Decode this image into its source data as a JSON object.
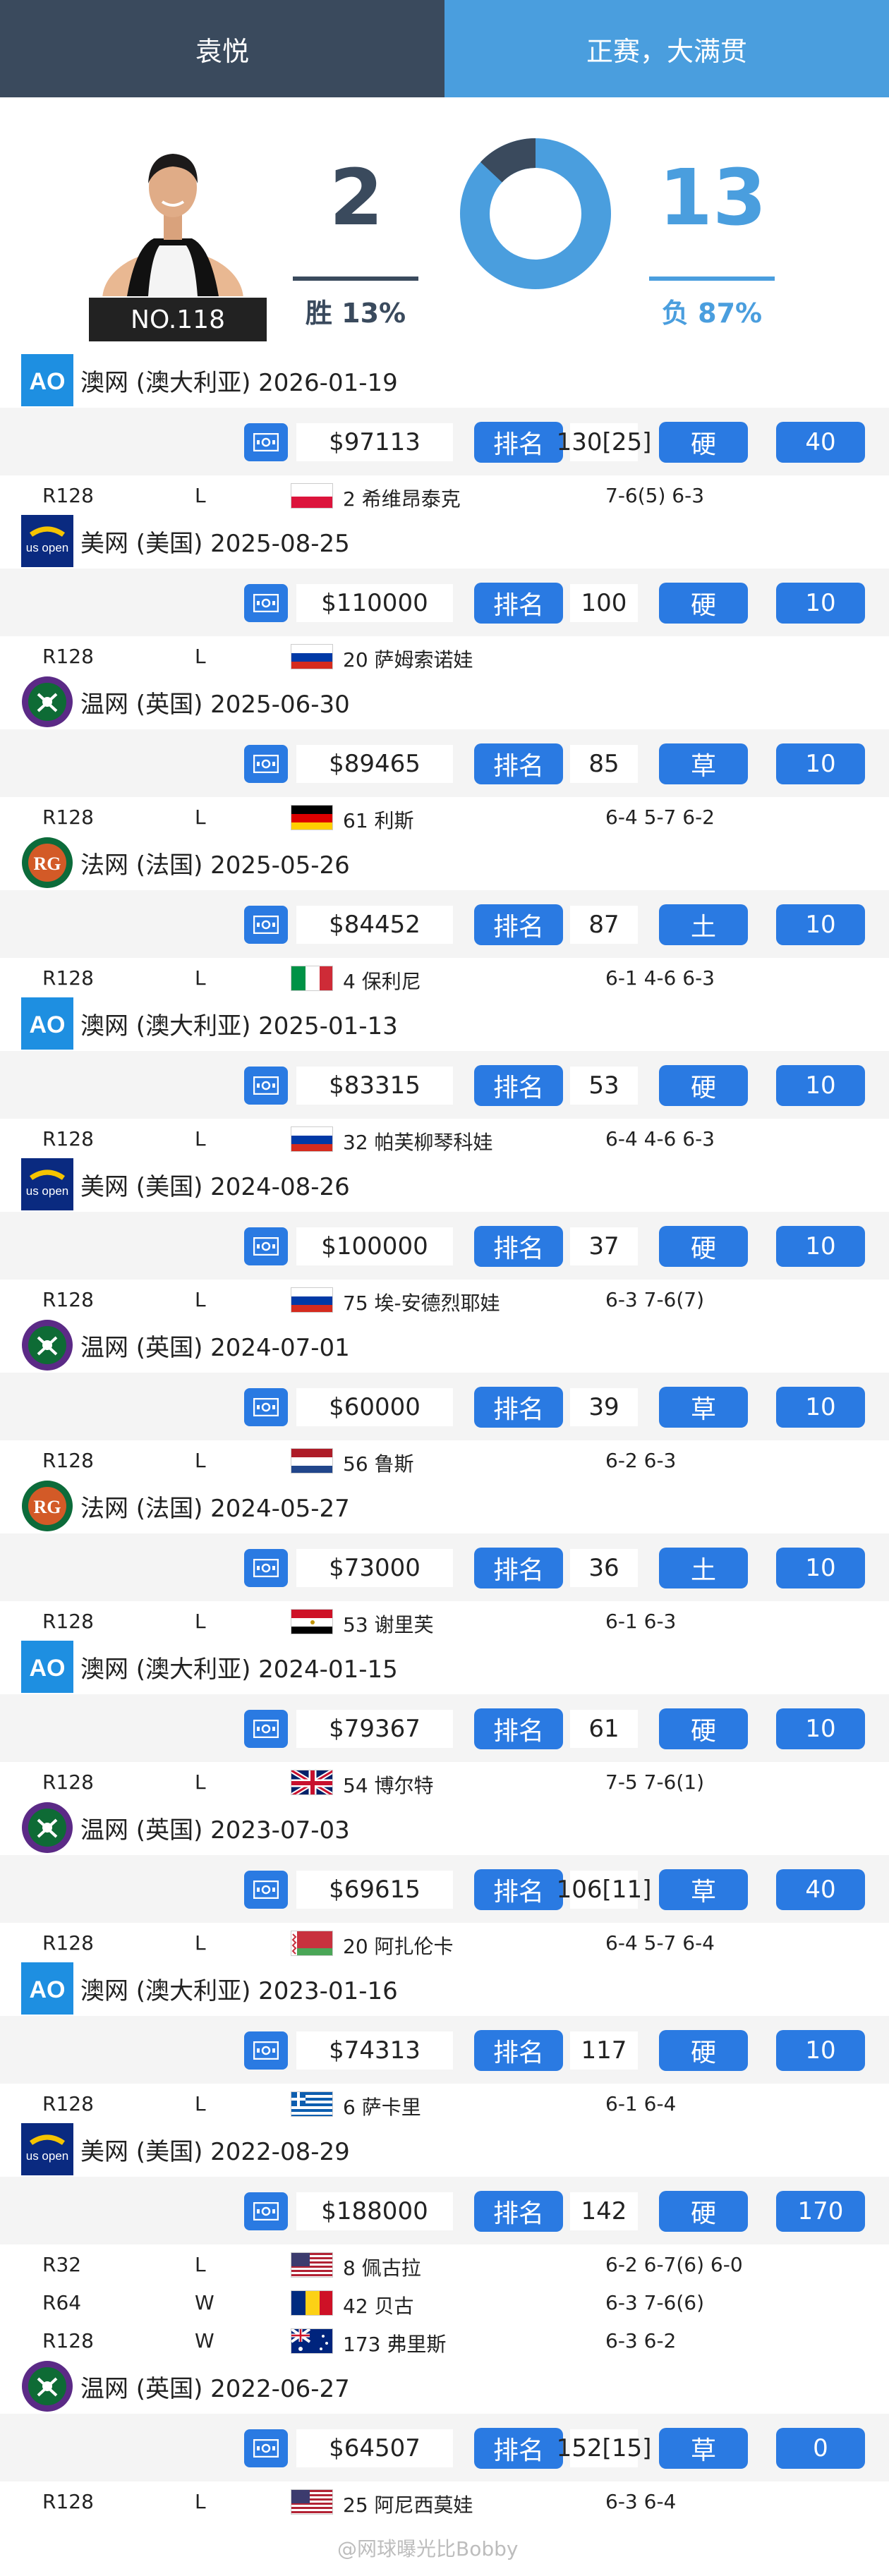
{
  "tabs": {
    "player": "袁悦",
    "mode": "正赛，大满贯"
  },
  "summary": {
    "rank": "NO.118",
    "wins": "2",
    "losses": "13",
    "win_label": "胜 13%",
    "loss_label": "负 87%",
    "win_fraction": 0.13
  },
  "colors": {
    "dark": "#3a4a5d",
    "accent": "#4a9ede",
    "button": "#2a7ae2"
  },
  "tournaments": [
    {
      "logo": "ao",
      "title": "澳网 (澳大利亚) 2026-01-19",
      "money": "$97113",
      "rank_label": "排名",
      "rank": "130[25]",
      "surface": "硬",
      "points": "40",
      "matches": [
        {
          "round": "R128",
          "result": "L",
          "flag": "poland",
          "opponent": "2 希维昂泰克",
          "score": "7-6(5) 6-3"
        }
      ]
    },
    {
      "logo": "uso",
      "title": "美网 (美国) 2025-08-25",
      "money": "$110000",
      "rank_label": "排名",
      "rank": "100",
      "surface": "硬",
      "points": "10",
      "matches": [
        {
          "round": "R128",
          "result": "L",
          "flag": "russia",
          "opponent": "20 萨姆索诺娃",
          "score": ""
        }
      ]
    },
    {
      "logo": "wim",
      "title": "温网 (英国) 2025-06-30",
      "money": "$89465",
      "rank_label": "排名",
      "rank": "85",
      "surface": "草",
      "points": "10",
      "matches": [
        {
          "round": "R128",
          "result": "L",
          "flag": "germany",
          "opponent": "61 利斯",
          "score": "6-4 5-7 6-2"
        }
      ]
    },
    {
      "logo": "rg",
      "title": "法网 (法国) 2025-05-26",
      "money": "$84452",
      "rank_label": "排名",
      "rank": "87",
      "surface": "土",
      "points": "10",
      "matches": [
        {
          "round": "R128",
          "result": "L",
          "flag": "italy",
          "opponent": "4 保利尼",
          "score": "6-1 4-6 6-3"
        }
      ]
    },
    {
      "logo": "ao",
      "title": "澳网 (澳大利亚) 2025-01-13",
      "money": "$83315",
      "rank_label": "排名",
      "rank": "53",
      "surface": "硬",
      "points": "10",
      "matches": [
        {
          "round": "R128",
          "result": "L",
          "flag": "russia",
          "opponent": "32 帕芙柳琴科娃",
          "score": "6-4 4-6 6-3"
        }
      ]
    },
    {
      "logo": "uso",
      "title": "美网 (美国) 2024-08-26",
      "money": "$100000",
      "rank_label": "排名",
      "rank": "37",
      "surface": "硬",
      "points": "10",
      "matches": [
        {
          "round": "R128",
          "result": "L",
          "flag": "russia",
          "opponent": "75 埃-安德烈耶娃",
          "score": "6-3 7-6(7)"
        }
      ]
    },
    {
      "logo": "wim",
      "title": "温网 (英国) 2024-07-01",
      "money": "$60000",
      "rank_label": "排名",
      "rank": "39",
      "surface": "草",
      "points": "10",
      "matches": [
        {
          "round": "R128",
          "result": "L",
          "flag": "netherlands",
          "opponent": "56 鲁斯",
          "score": "6-2 6-3"
        }
      ]
    },
    {
      "logo": "rg",
      "title": "法网 (法国) 2024-05-27",
      "money": "$73000",
      "rank_label": "排名",
      "rank": "36",
      "surface": "土",
      "points": "10",
      "matches": [
        {
          "round": "R128",
          "result": "L",
          "flag": "egypt",
          "opponent": "53 谢里芙",
          "score": "6-1 6-3"
        }
      ]
    },
    {
      "logo": "ao",
      "title": "澳网 (澳大利亚) 2024-01-15",
      "money": "$79367",
      "rank_label": "排名",
      "rank": "61",
      "surface": "硬",
      "points": "10",
      "matches": [
        {
          "round": "R128",
          "result": "L",
          "flag": "uk",
          "opponent": "54 博尔特",
          "score": "7-5 7-6(1)"
        }
      ]
    },
    {
      "logo": "wim",
      "title": "温网 (英国) 2023-07-03",
      "money": "$69615",
      "rank_label": "排名",
      "rank": "106[11]",
      "surface": "草",
      "points": "40",
      "matches": [
        {
          "round": "R128",
          "result": "L",
          "flag": "belarus",
          "opponent": "20 阿扎伦卡",
          "score": "6-4 5-7 6-4"
        }
      ]
    },
    {
      "logo": "ao",
      "title": "澳网 (澳大利亚) 2023-01-16",
      "money": "$74313",
      "rank_label": "排名",
      "rank": "117",
      "surface": "硬",
      "points": "10",
      "matches": [
        {
          "round": "R128",
          "result": "L",
          "flag": "greece",
          "opponent": "6 萨卡里",
          "score": "6-1 6-4"
        }
      ]
    },
    {
      "logo": "uso",
      "title": "美网 (美国) 2022-08-29",
      "money": "$188000",
      "rank_label": "排名",
      "rank": "142",
      "surface": "硬",
      "points": "170",
      "matches": [
        {
          "round": "R32",
          "result": "L",
          "flag": "usa",
          "opponent": "8 佩古拉",
          "score": "6-2 6-7(6) 6-0"
        },
        {
          "round": "R64",
          "result": "W",
          "flag": "romania",
          "opponent": "42 贝古",
          "score": "6-3 7-6(6)"
        },
        {
          "round": "R128",
          "result": "W",
          "flag": "australia",
          "opponent": "173 弗里斯",
          "score": "6-3 6-2"
        }
      ]
    },
    {
      "logo": "wim",
      "title": "温网 (英国) 2022-06-27",
      "money": "$64507",
      "rank_label": "排名",
      "rank": "152[15]",
      "surface": "草",
      "points": "0",
      "matches": [
        {
          "round": "R128",
          "result": "L",
          "flag": "usa",
          "opponent": "25 阿尼西莫娃",
          "score": "6-3 6-4"
        }
      ]
    }
  ],
  "watermark": "@网球曝光比Bobby"
}
